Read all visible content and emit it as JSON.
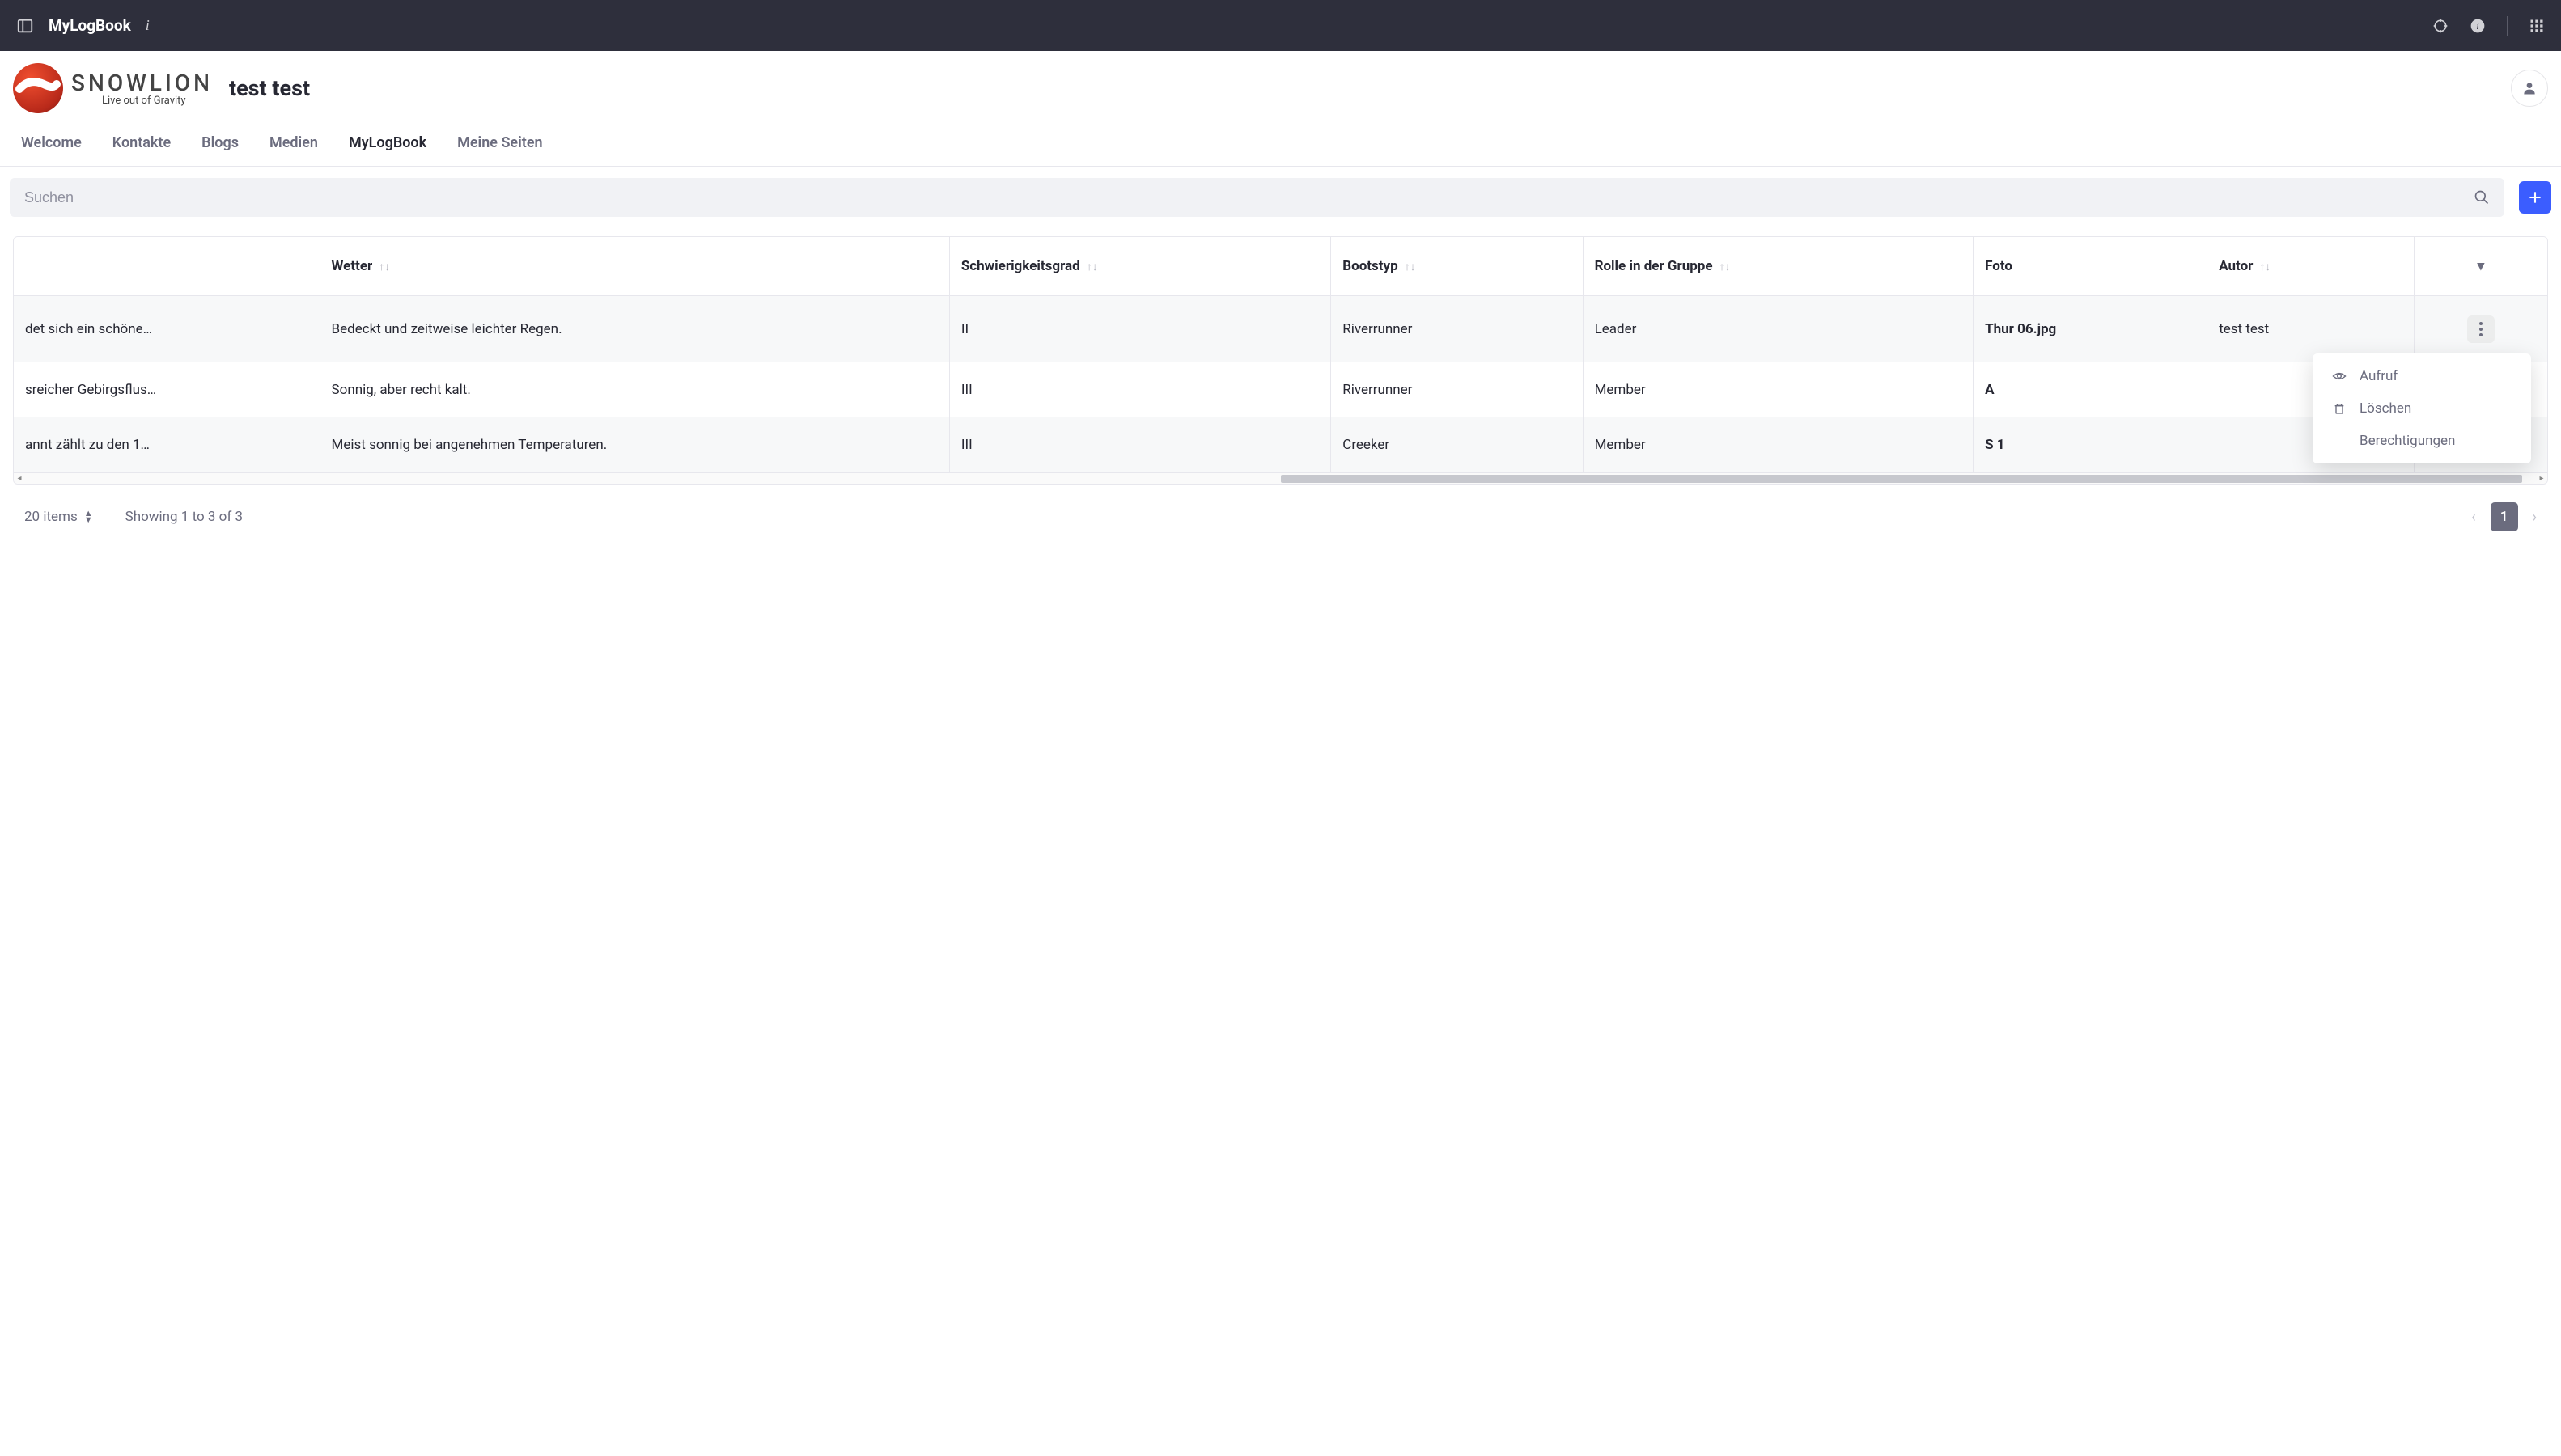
{
  "topbar": {
    "title": "MyLogBook"
  },
  "brand": {
    "name": "SNOWLION",
    "tagline": "Live out of Gravity",
    "page_label": "test test"
  },
  "nav": {
    "items": [
      "Welcome",
      "Kontakte",
      "Blogs",
      "Medien",
      "MyLogBook",
      "Meine Seiten"
    ],
    "active_index": 4
  },
  "search": {
    "placeholder": "Suchen"
  },
  "table": {
    "columns": [
      {
        "label": "",
        "sortable": false
      },
      {
        "label": "Wetter",
        "sortable": true
      },
      {
        "label": "Schwierigkeitsgrad",
        "sortable": true
      },
      {
        "label": "Bootstyp",
        "sortable": true
      },
      {
        "label": "Rolle in der Gruppe",
        "sortable": true
      },
      {
        "label": "Foto",
        "sortable": false
      },
      {
        "label": "Autor",
        "sortable": true
      }
    ],
    "rows": [
      {
        "c0": "det sich ein schöne…",
        "wetter": "Bedeckt und zeitweise leichter Regen.",
        "schwierigkeit": "II",
        "bootstyp": "Riverrunner",
        "rolle": "Leader",
        "foto": "Thur 06.jpg",
        "autor": "test test"
      },
      {
        "c0": "sreicher Gebirgsflus…",
        "wetter": "Sonnig, aber recht kalt.",
        "schwierigkeit": "III",
        "bootstyp": "Riverrunner",
        "rolle": "Member",
        "foto": "A",
        "autor": ""
      },
      {
        "c0": "annt zählt zu den 1…",
        "wetter": "Meist sonnig bei angenehmen Temperaturen.",
        "schwierigkeit": "III",
        "bootstyp": "Creeker",
        "rolle": "Member",
        "foto": "S\n1",
        "autor": ""
      }
    ]
  },
  "context_menu": {
    "items": [
      {
        "label": "Aufruf",
        "icon": "eye"
      },
      {
        "label": "Löschen",
        "icon": "trash"
      },
      {
        "label": "Berechtigungen",
        "icon": ""
      }
    ]
  },
  "pagination": {
    "items_label": "20 items",
    "showing_label": "Showing 1 to 3 of 3",
    "current_page": "1"
  }
}
